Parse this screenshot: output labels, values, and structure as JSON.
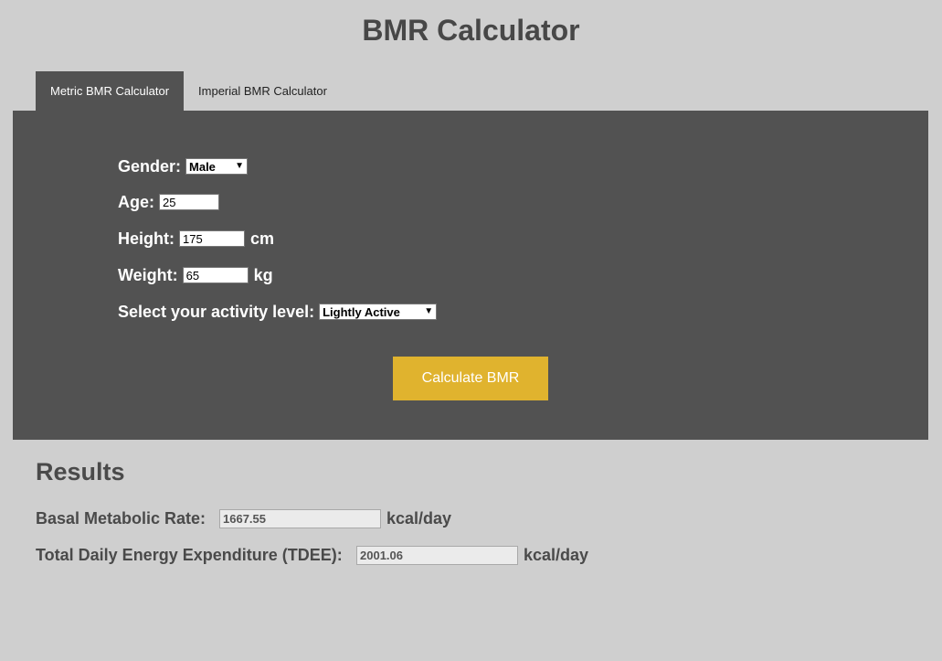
{
  "title": "BMR Calculator",
  "tabs": [
    {
      "label": "Metric BMR Calculator",
      "active": true
    },
    {
      "label": "Imperial BMR Calculator",
      "active": false
    }
  ],
  "form": {
    "gender": {
      "label": "Gender:",
      "value": "Male"
    },
    "age": {
      "label": "Age:",
      "value": "25"
    },
    "height": {
      "label": "Height:",
      "value": "175",
      "unit": "cm"
    },
    "weight": {
      "label": "Weight:",
      "value": "65",
      "unit": "kg"
    },
    "activity": {
      "label": "Select your activity level:",
      "value": "Lightly Active"
    },
    "calculate_label": "Calculate BMR"
  },
  "results": {
    "title": "Results",
    "bmr": {
      "label": "Basal Metabolic Rate:",
      "value": "1667.55",
      "unit": "kcal/day"
    },
    "tdee": {
      "label": "Total Daily Energy Expenditure (TDEE):",
      "value": "2001.06",
      "unit": "kcal/day"
    }
  },
  "colors": {
    "background": "#cfcfcf",
    "panel": "#525252",
    "accent": "#e0b32e"
  },
  "icons": {
    "select_arrow": "chevron-down-icon"
  }
}
